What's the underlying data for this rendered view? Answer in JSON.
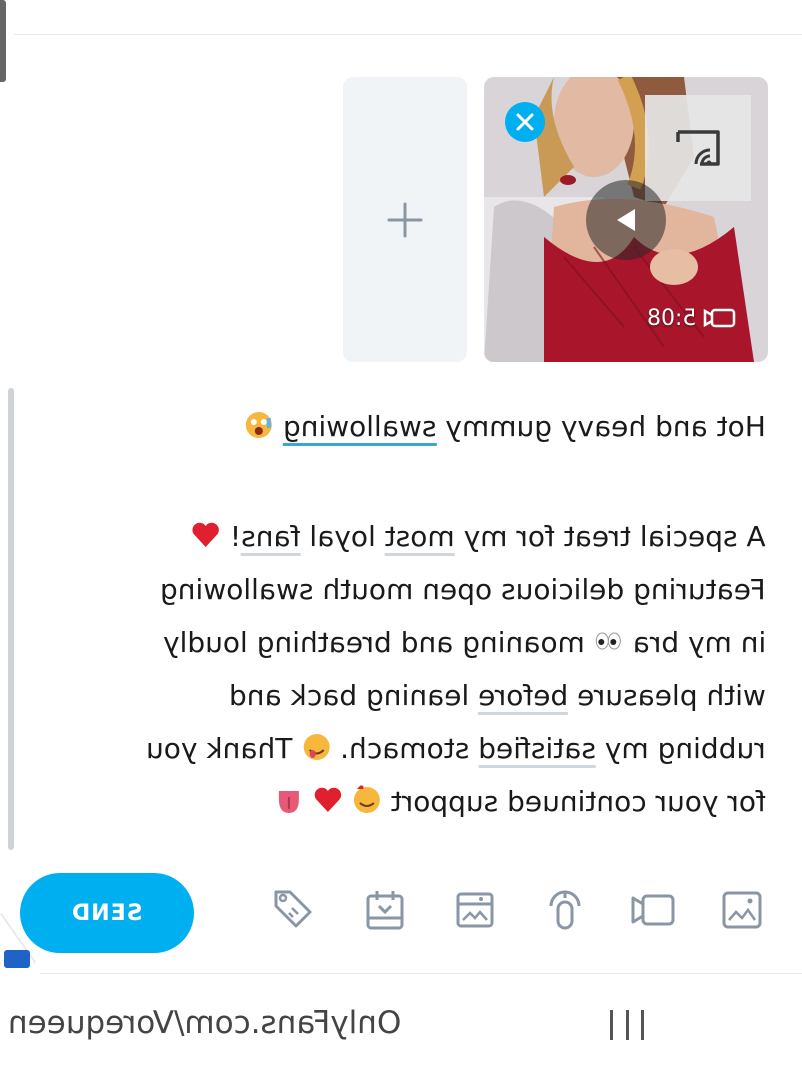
{
  "composer": {
    "add_media_icon": "plus-icon",
    "attachment": {
      "duration": "5:08",
      "remove_icon": "close-icon",
      "cast_icon": "cast-icon",
      "play_icon": "play-icon"
    }
  },
  "caption": {
    "line1": "Hot and heavy gummy swallowing",
    "line1_emoji": "😵",
    "p2": [
      "A special treat for my most loyal fans!",
      "Featuring delicious open mouth swallowing",
      "in my bra",
      "moaning and breathing loudly",
      "with pleasure before leaning back and",
      "rubbing my satisfied stomach.",
      "Thank you",
      "for your continued support"
    ],
    "emojis": {
      "heart": "❤️",
      "eyes": "👀",
      "yum": "😋",
      "love": "🥰",
      "tongue": "👅"
    }
  },
  "toolbar": {
    "send_label": "SEND",
    "icons": [
      "image-icon",
      "video-icon",
      "mic-icon",
      "gallery-icon",
      "calendar-icon",
      "price-tag-icon"
    ]
  },
  "browser": {
    "url": "OnlyFans.com/Vorequeen"
  },
  "colors": {
    "accent": "#00aff0"
  }
}
